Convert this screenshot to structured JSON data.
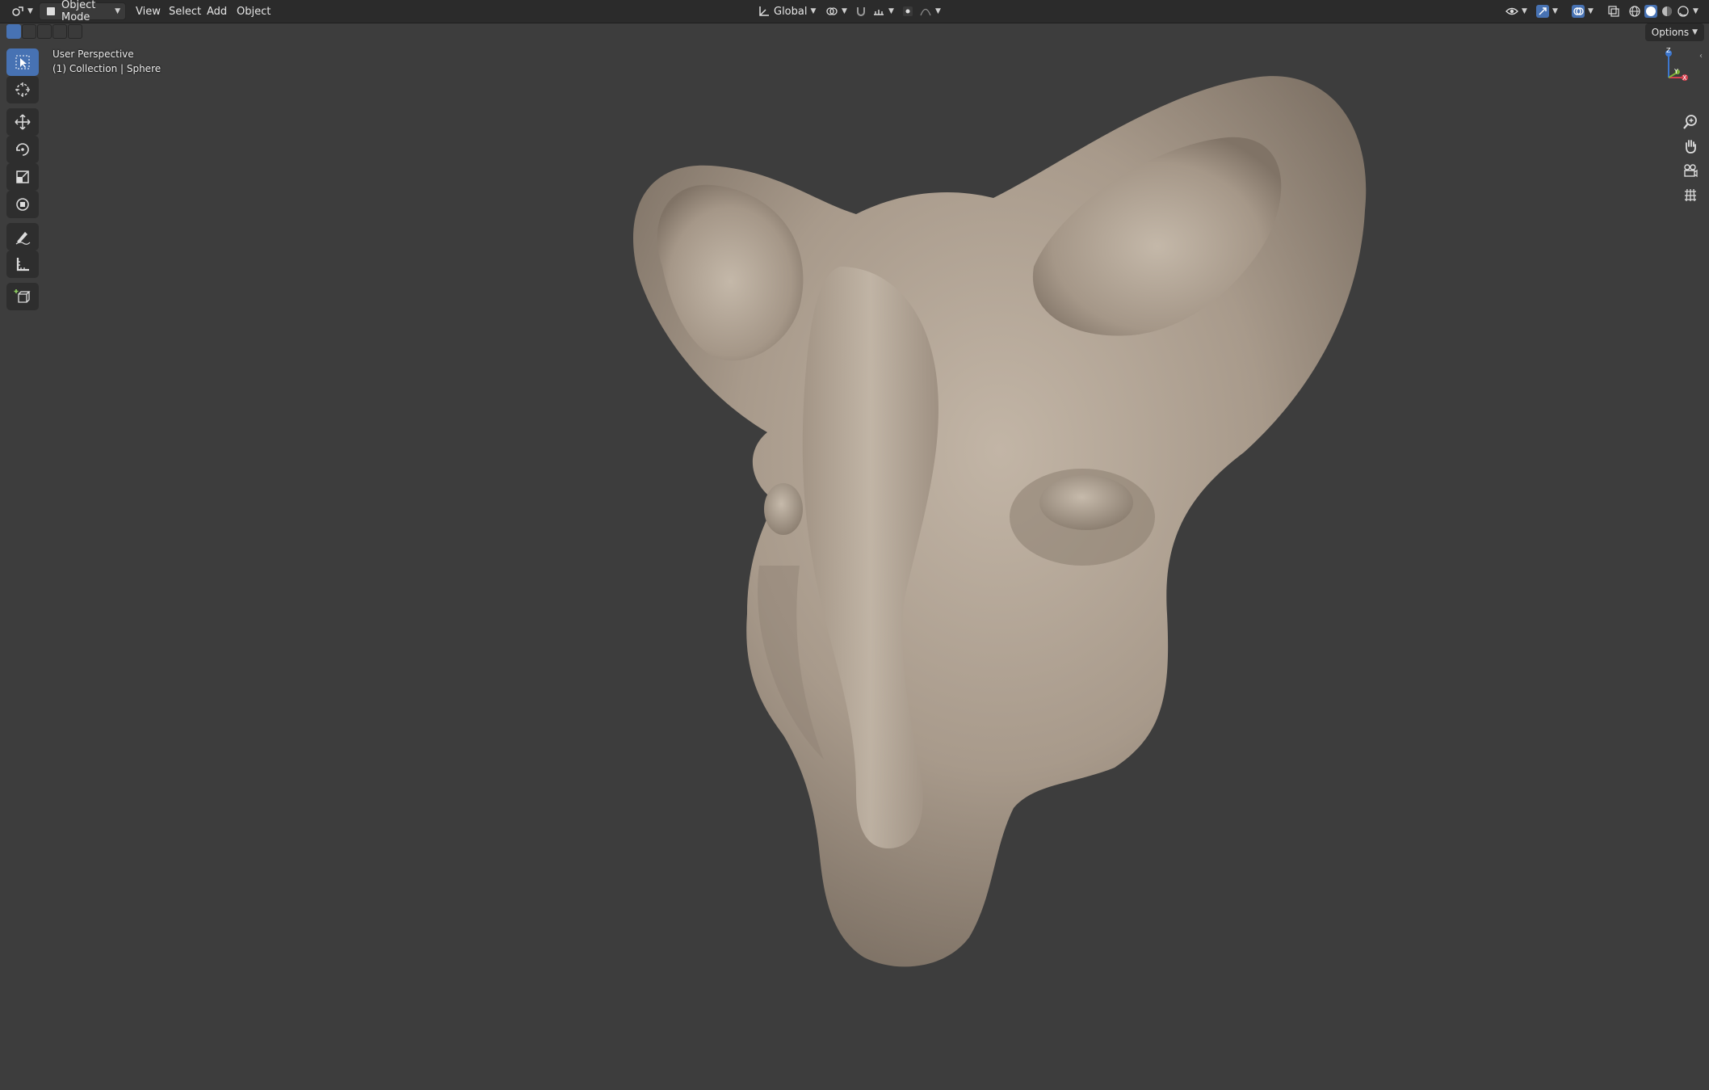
{
  "header": {
    "mode_label": "Object Mode",
    "menus": [
      "View",
      "Select",
      "Add",
      "Object"
    ],
    "transform_orientation": "Global"
  },
  "subheader": {
    "options_label": "Options"
  },
  "viewport": {
    "view_name": "User Perspective",
    "collection_info": "(1) Collection | Sphere",
    "background_color": "#3d3d3d",
    "model_color": "#a79a8c"
  },
  "toolbar": {
    "tools": [
      "select-box",
      "cursor",
      "move",
      "rotate",
      "scale",
      "transform",
      "annotate",
      "measure",
      "add-cube"
    ],
    "active_tool": "select-box"
  },
  "navigation": {
    "axes": [
      "Z",
      "Y",
      "X"
    ],
    "buttons": [
      "zoom",
      "pan",
      "camera",
      "ortho-toggle"
    ]
  },
  "colors": {
    "accent": "#4772b3",
    "header_bg": "#2b2b2b",
    "axis_x": "#d6414f",
    "axis_y": "#7fb33a",
    "axis_z": "#3d77cf"
  }
}
